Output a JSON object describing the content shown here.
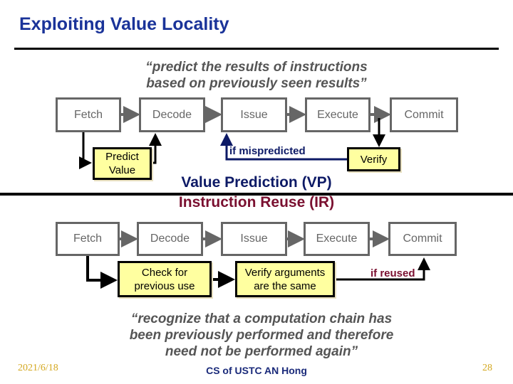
{
  "slide": {
    "title": "Exploiting Value Locality",
    "vp_quote_line1": "“predict the results of instructions",
    "vp_quote_line2": "based on previously seen results”",
    "vp_pipeline": {
      "stages": [
        "Fetch",
        "Decode",
        "Issue",
        "Execute",
        "Commit"
      ],
      "predict_box": [
        "Predict",
        "Value"
      ],
      "verify_box": "Verify",
      "mispredict_label": "if mispredicted"
    },
    "section_vp_label": "Value Prediction (VP)",
    "section_ir_label": "Instruction Reuse (IR)",
    "ir_pipeline": {
      "stages": [
        "Fetch",
        "Decode",
        "Issue",
        "Execute",
        "Commit"
      ],
      "check_box": [
        "Check for",
        "previous use"
      ],
      "verify_args_box": [
        "Verify arguments",
        "are the same"
      ],
      "reused_label": "if reused"
    },
    "ir_quote_line1": "“recognize that a computation chain has",
    "ir_quote_line2": "been previously performed and therefore",
    "ir_quote_line3": "need not be performed again”"
  },
  "footer": {
    "date": "2021/6/18",
    "author": "CS of USTC AN Hong",
    "page": "28"
  },
  "colors": {
    "title": "#1a3399",
    "vp_accent": "#0d1a66",
    "ir_accent": "#7a1030",
    "highlight_box": "#ffffa0",
    "stage_border": "#666666",
    "footer_gold": "#d4a820"
  }
}
